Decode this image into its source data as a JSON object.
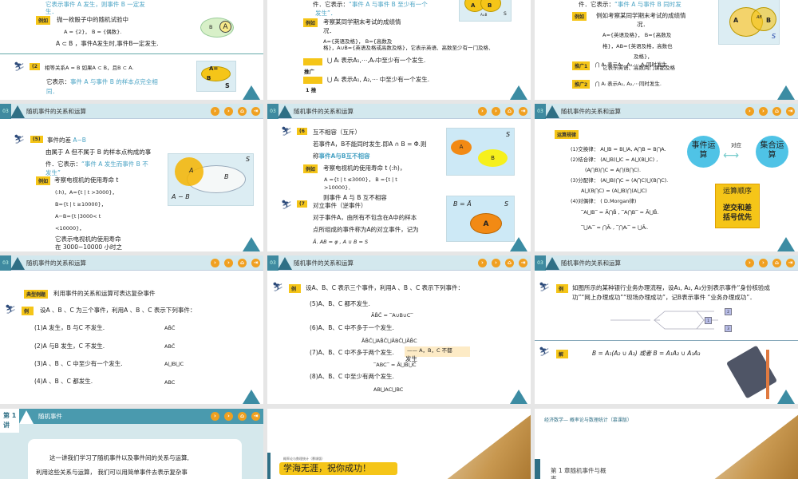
{
  "header_title": "随机事件的关系和运算",
  "section_num": "03",
  "nav_icons": [
    "next-icon",
    "next-icon",
    "home-icon",
    "end-icon"
  ],
  "tags": {
    "example": "例如",
    "promo1": "推广1",
    "promo2": "推广2",
    "promo": "推广",
    "typical": "典型例题",
    "ex": "例",
    "sol": "解",
    "rules": "运算规律"
  },
  "s1": {
    "top": "它表示事件 A 发生，则事件 B 一定发",
    "top2": "生．",
    "ex1": "抛一枚骰子中的随机试验中",
    "ex2": "A = {2}，  B = {偶数}.",
    "ex3": "A ⊂ B ，事件A发生时,事件B一定发生.",
    "num": "(2",
    "l1": "相等关系A = B    如果A ⊂ B，且B ⊂ A.",
    "l2a": "它表示：",
    "l2b": "事件 A 与事件 B 的样本点完全相",
    "l2c": "同．",
    "venn_a": "A",
    "venn_b": "B",
    "venn_eq": "A=",
    "venn_eq2": "B",
    "venn_s": "S"
  },
  "s2": {
    "top": "件．它表示：",
    "topb": "“事件 A 与事件 B 至少有一个",
    "top2": "发生”．",
    "ex1": "考察某同学期末考试的成绩情",
    "ex2": "况．",
    "ex3": "A={英语及格}，  B={高数及",
    "ex4": "格}，A∪B={英语及格或高数及格}，它表示英语、高数至少有一门及格．",
    "p1": "⋃ Aᵢ 表示A₁,⋯,Aₙ中至少有一个发生.",
    "p2": "⋃ Aᵢ 表示A₁, A₂,⋯ 中至少有一个发生.",
    "promo": "推广",
    "promo1": "1 推",
    "venn_a": "A",
    "venn_b": "B",
    "venn_u": "A∪B",
    "venn_s": "S"
  },
  "s3": {
    "top": "件．它表示：",
    "topb": "“事件 A 与事件 B 同时发",
    "ex1": "例如考察某同学期末考试的成绩情",
    "ex2": "况．",
    "ex3": "A={英语及格}，  B={高数及",
    "ex4": "格}，AB={英语及格，高数也",
    "ex5": "及格}，",
    "ex6": "它表示英语、高数两门课都及格",
    "p1": "⋂ Aᵢ 表示A₁, A₂,⋯,Aₙ同时发生.",
    "p2": "⋂ Aᵢ 表示A₁, A₂,⋯同时发生.",
    "venn_a": "A",
    "venn_b": "B",
    "venn_ab": "AB",
    "venn_s": "S"
  },
  "s4": {
    "num": "(5)",
    "title": "事件的差",
    "titleb": "A−B",
    "l1": "由属于 A  但不属于 B 的样本点构成的事",
    "l2": "件．它表示：",
    "l2b": "“事件 A 发生而事件 B 不",
    "l3": "发生”",
    "ex1": "考察电视机的使用寿命  t",
    "ex2": "(:h)，A={t | t >3000}，",
    "ex3": "B={t | t ≥10000}，",
    "ex4": "A−B={t |3000< t",
    "ex5": "<10000}，",
    "ex6": "它表示电视机的使用寿命",
    "ex7": "在 3000−10000 小时之",
    "venn_a": "A",
    "venn_b": "B",
    "venn_s": "S",
    "venn_diff": "A − B"
  },
  "s5": {
    "num6": "(6",
    "t6": "互不相容（互斥）",
    "l1": "若事件A，B不能同时发生.即A ∩ B = Φ.则",
    "l2a": "称",
    "l2b": "事件A与B互不相容",
    "ex1": "考察电视机的使用寿命  t (:h)，",
    "ex2": "A ={t | t ≤3000}，  B ={t | t",
    "ex3": ">10000}．",
    "ex4": "则事件 A 与 B 互不相容",
    "num7": "(7",
    "t7": "对立事件（逆事件）",
    "l3": "对于事件A，由所有不包含在A中的样本",
    "l4": "点所组成的事件称为A的对立事件，记为",
    "l5": "Ā. AB = φ , A ∪ B = S",
    "venn_a": "A",
    "venn_b": "B",
    "venn_s": "S",
    "venn2_eq": "B = Ā",
    "venn2_a": "A",
    "venn2_s": "S"
  },
  "s6": {
    "r1": "(1)交换律： A⋃B = B⋃A,  A⋂B = B⋂A.",
    "r2": "(2)结合律： (A⋃B)⋃C = A⋃(B⋃C) ,",
    "r2b": "(A⋂B)⋂C = A⋂(B⋂C).",
    "r3": "(3)分配律： (A⋃B)⋂C = (A⋂C)⋃(B⋂C).",
    "r3b": "A⋃(B⋂C) = (A⋃B)⋂(A⋃C)",
    "r4": "(4)对偶律：  ( D.Morgan律)",
    "r4b": "‾A⋃B‾ = Ā⋂B̄ ,   ‾A⋂B‾ = Ā⋃B̄.",
    "r4c": "‾⋃Aᵢ‾ = ⋂Āᵢ ,    ‾⋂Aᵢ‾ = ⋃Āᵢ.",
    "c1": "事件运算",
    "c2": "集合运算",
    "corr": "对应",
    "order1": "运算顺序",
    "order2": "逆交和差",
    "order3": "括号优先"
  },
  "s7": {
    "intro": "利用事件的关系和运算可表达复杂事件",
    "q": "设A 、B 、C 为三个事件，利用A 、B 、C 表示下列事件：",
    "items": [
      {
        "q": "(1)A 发生，B 与C 不发生.",
        "a": "AB̄C̄"
      },
      {
        "q": "(2)A 与B 发生，C 不发生.",
        "a": "ABC̄"
      },
      {
        "q": "(3)A 、B 、C 中至少有一个发生.",
        "a": "A⋃B⋃C"
      },
      {
        "q": "(4)A 、B 、C 都发生.",
        "a": "ABC"
      }
    ]
  },
  "s8": {
    "q": "设A、B、C 表示三个事件，利用A 、B 、C 表示下列事件：",
    "items": [
      {
        "q": "(5)A、B、C 都不发生.",
        "a": "ĀB̄C̄ = ‾A∪B∪C‾"
      },
      {
        "q": "(6)A、B、C 中不多于一个发生.",
        "a": "ĀB̄C̄⋃AB̄C̄⋃ĀBC̄⋃ĀB̄C"
      },
      {
        "q": "(7)A、B、C 中不多于两个发生.",
        "a": "‾ABC‾ = Ā⋃B̄⋃C̄"
      },
      {
        "q": "(8)A、B、C 中至少有两个发生.",
        "a": "AB⋃AC⋃BC"
      }
    ],
    "note": "—— A，B，C  不都",
    "note2": "发生"
  },
  "s9": {
    "q1": "如图所示的某种银行业务办理流程，设A₁, A₂, A₃分别表示事件“身份核验成",
    "q2": "功”“网上办理成功”“现场办理成功”，记B表示事件 “业务办理成功”．",
    "boxes": [
      "1",
      "2",
      "3"
    ],
    "sol": "B = A₁(A₂ ∪ A₃) 或者 B = A₁A₂ ∪ A₁A₃"
  },
  "s10": {
    "lecture": "第 1",
    "lecture2": "讲",
    "title": "随机事件",
    "p1": "这一讲我们学习了随机事件以及事件间的关系与运算,",
    "p2": "利用这些关系与运算， 我们可以用简单事件去表示复杂事"
  },
  "s11": {
    "sub": "概率论与数理统计（慕课版）",
    "banner": "学海无涯，祝你成功！"
  },
  "s12": {
    "book": "经济数学— 概率论与数理统计（慕课版）",
    "chapter": "第 1 章随机事件与概",
    "chapter2": "率"
  }
}
